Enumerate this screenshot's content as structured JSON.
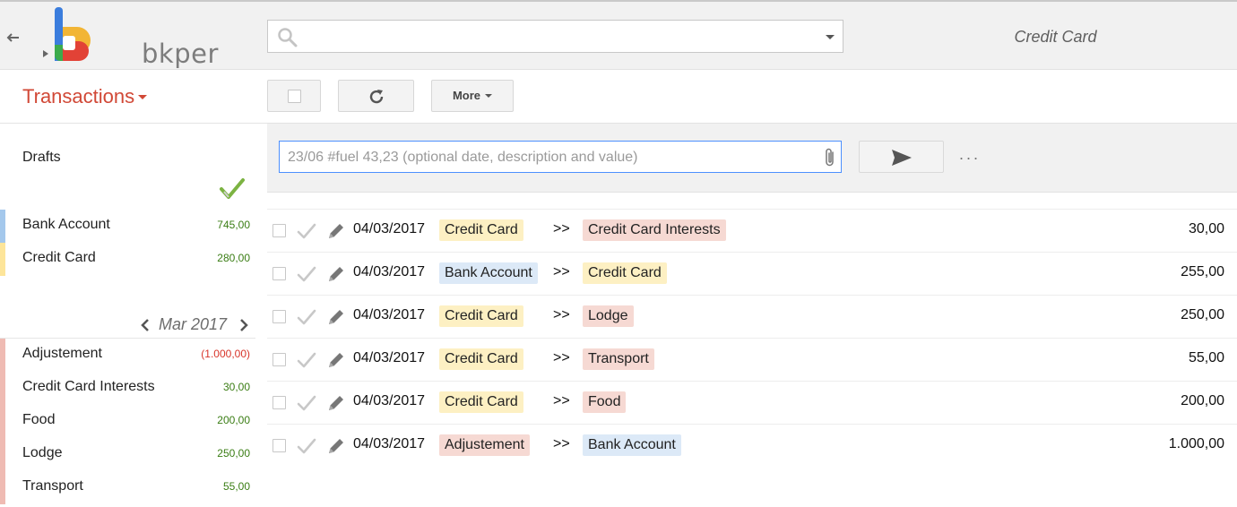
{
  "header": {
    "logo_text": "bkper",
    "book_title": "Credit Card",
    "search": {
      "value": "",
      "placeholder": ""
    }
  },
  "toolbar": {
    "view_title": "Transactions",
    "more_label": "More"
  },
  "composer": {
    "placeholder": "23/06 #fuel 43,23 (optional date, description and value)",
    "more_dots": "..."
  },
  "sidebar": {
    "drafts_label": "Drafts",
    "accounts": [
      {
        "name": "Bank Account",
        "balance": "745,00",
        "color": "#a4c8ec",
        "balance_style": "pos"
      },
      {
        "name": "Credit Card",
        "balance": "280,00",
        "color": "#fde59a",
        "balance_style": "pos"
      }
    ],
    "period_label": "Mar 2017",
    "incoming_outgoing": [
      {
        "name": "Adjustement",
        "balance": "(1.000,00)",
        "color": "#efbbb3",
        "balance_style": "neg"
      },
      {
        "name": "Credit Card Interests",
        "balance": "30,00",
        "color": "#efbbb3",
        "balance_style": "pos"
      },
      {
        "name": "Food",
        "balance": "200,00",
        "color": "#efbbb3",
        "balance_style": "pos"
      },
      {
        "name": "Lodge",
        "balance": "250,00",
        "color": "#efbbb3",
        "balance_style": "pos"
      },
      {
        "name": "Transport",
        "balance": "55,00",
        "color": "#efbbb3",
        "balance_style": "pos"
      }
    ]
  },
  "tag_colors": {
    "asset": "#dce9f7",
    "liability": "#fdf0c3",
    "expense": "#f6d9d3"
  },
  "transactions": [
    {
      "date": "04/03/2017",
      "from": "Credit Card",
      "from_type": "liability",
      "arrow": ">>",
      "to": "Credit Card Interests",
      "to_type": "expense",
      "amount": "30,00"
    },
    {
      "date": "04/03/2017",
      "from": "Bank Account",
      "from_type": "asset",
      "arrow": ">>",
      "to": "Credit Card",
      "to_type": "liability",
      "amount": "255,00"
    },
    {
      "date": "04/03/2017",
      "from": "Credit Card",
      "from_type": "liability",
      "arrow": ">>",
      "to": "Lodge",
      "to_type": "expense",
      "amount": "250,00"
    },
    {
      "date": "04/03/2017",
      "from": "Credit Card",
      "from_type": "liability",
      "arrow": ">>",
      "to": "Transport",
      "to_type": "expense",
      "amount": "55,00"
    },
    {
      "date": "04/03/2017",
      "from": "Credit Card",
      "from_type": "liability",
      "arrow": ">>",
      "to": "Food",
      "to_type": "expense",
      "amount": "200,00"
    },
    {
      "date": "04/03/2017",
      "from": "Adjustement",
      "from_type": "expense",
      "arrow": ">>",
      "to": "Bank Account",
      "to_type": "asset",
      "amount": "1.000,00"
    }
  ]
}
